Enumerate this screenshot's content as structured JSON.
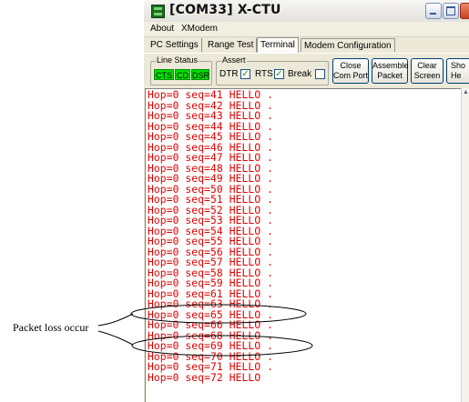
{
  "window": {
    "title": "[COM33] X-CTU"
  },
  "menu": {
    "items": [
      "About",
      "XModem"
    ]
  },
  "tabs": [
    {
      "label": "PC Settings",
      "active": false
    },
    {
      "label": "Range Test",
      "active": false
    },
    {
      "label": "Terminal",
      "active": true
    },
    {
      "label": "Modem Configuration",
      "active": false
    }
  ],
  "line_status": {
    "title": "Line Status",
    "indicators": [
      "CTS",
      "CD",
      "DSR"
    ],
    "indicator_color": "#00e000"
  },
  "assert": {
    "title": "Assert",
    "checkboxes": [
      {
        "label": "DTR",
        "checked": true
      },
      {
        "label": "RTS",
        "checked": true
      },
      {
        "label": "Break",
        "checked": false
      }
    ]
  },
  "buttons": {
    "close_com_port": [
      "Close",
      "Com Port"
    ],
    "assemble_packet": [
      "Assemble",
      "Packet"
    ],
    "clear_screen": [
      "Clear",
      "Screen"
    ],
    "show_hex": [
      "Sho",
      "He"
    ]
  },
  "terminal": {
    "text_color": "#e00000",
    "lines": [
      "Hop=0 seq=41 HELLO .",
      "Hop=0 seq=42 HELLO .",
      "Hop=0 seq=43 HELLO .",
      "Hop=0 seq=44 HELLO .",
      "Hop=0 seq=45 HELLO .",
      "Hop=0 seq=46 HELLO .",
      "Hop=0 seq=47 HELLO .",
      "Hop=0 seq=48 HELLO .",
      "Hop=0 seq=49 HELLO .",
      "Hop=0 seq=50 HELLO .",
      "Hop=0 seq=51 HELLO .",
      "Hop=0 seq=52 HELLO .",
      "Hop=0 seq=53 HELLO .",
      "Hop=0 seq=54 HELLO .",
      "Hop=0 seq=55 HELLO .",
      "Hop=0 seq=56 HELLO .",
      "Hop=0 seq=57 HELLO .",
      "Hop=0 seq=58 HELLO .",
      "Hop=0 seq=59 HELLO .",
      "Hop=0 seq=61 HELLO .",
      "Hop=0 seq=63 HELLO .",
      "Hop=0 seq=65 HELLO .",
      "Hop=0 seq=66 HELLO .",
      "Hop=0 seq=68 HELLO .",
      "Hop=0 seq=69 HELLO .",
      "Hop=0 seq=70 HELLO .",
      "Hop=0 seq=71 HELLO .",
      "Hop=0 seq=72 HELLO"
    ]
  },
  "annotation": {
    "label": "Packet loss occur"
  }
}
